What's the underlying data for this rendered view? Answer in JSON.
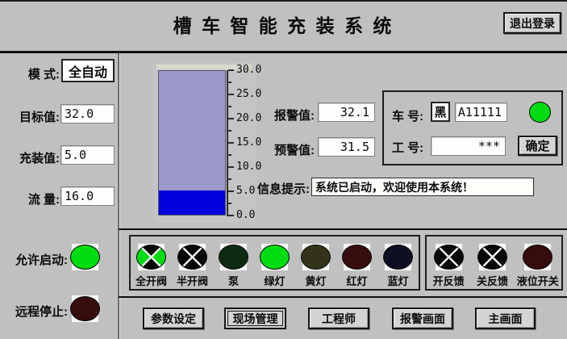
{
  "window": {
    "title": "槽 车 智 能 充 装 系 统",
    "logout": "退出登录"
  },
  "left_panel": {
    "mode_label": "模  式:",
    "mode_value": "全自动",
    "target_label": "目标值:",
    "target_value": "32.0",
    "fill_label": "充装值:",
    "fill_value": "5.0",
    "flow_label": "流 量:",
    "flow_value": "16.0",
    "allow_start_label": "允许启动:",
    "allow_start_state": "on-green",
    "remote_stop_label": "远程停止:",
    "remote_stop_state": "off-dark-red"
  },
  "gauge": {
    "min": 0,
    "max": 30,
    "value": 5,
    "tick_labels": [
      "30.0",
      "25.0",
      "20.0",
      "15.0",
      "10.0",
      "5.0",
      "0.0"
    ],
    "bar_color": "#9a99ca",
    "fill_color": "#0202dd"
  },
  "setpoints": {
    "alarm_label": "报警值:",
    "alarm_value": "32.1",
    "warn_label": "预警值:",
    "warn_value": "31.5"
  },
  "message": {
    "label": "信息提示:",
    "text": "系统已启动，欢迎使用本系统！"
  },
  "vehicle_panel": {
    "vehicle_label": "车  号:",
    "plate_prefix": "黑",
    "plate_number": "A11111",
    "plate_light_state": "on-green",
    "worker_label": "工  号:",
    "worker_value": "***",
    "confirm_label": "确定"
  },
  "indicators": {
    "left_group": [
      {
        "label": "全开阀",
        "state": "valve-open-green"
      },
      {
        "label": "半开阀",
        "state": "valve-black"
      },
      {
        "label": "泵",
        "state": "off-dark-green"
      },
      {
        "label": "绿灯",
        "state": "on-green"
      },
      {
        "label": "黄灯",
        "state": "off-dark-yellow"
      },
      {
        "label": "红灯",
        "state": "off-dark-red"
      },
      {
        "label": "蓝灯",
        "state": "off-dark-blue"
      }
    ],
    "right_group": [
      {
        "label": "开反馈",
        "state": "valve-black"
      },
      {
        "label": "关反馈",
        "state": "valve-black"
      },
      {
        "label": "液位开关",
        "state": "off-dark-red"
      }
    ]
  },
  "nav_buttons": [
    {
      "label": "参数设定",
      "active": false
    },
    {
      "label": "现场管理",
      "active": true
    },
    {
      "label": "工程师",
      "active": false
    },
    {
      "label": "报警画面",
      "active": false
    },
    {
      "label": "主画面",
      "active": false
    }
  ],
  "lamp_colors": {
    "on-green": "#00dc12",
    "off-dark-green": "#0d2b10",
    "off-dark-yellow": "#33331a",
    "off-dark-red": "#360c0c",
    "off-dark-blue": "#0e0e24",
    "valve-open-green": "#00dc12",
    "valve-black": "#070707"
  }
}
